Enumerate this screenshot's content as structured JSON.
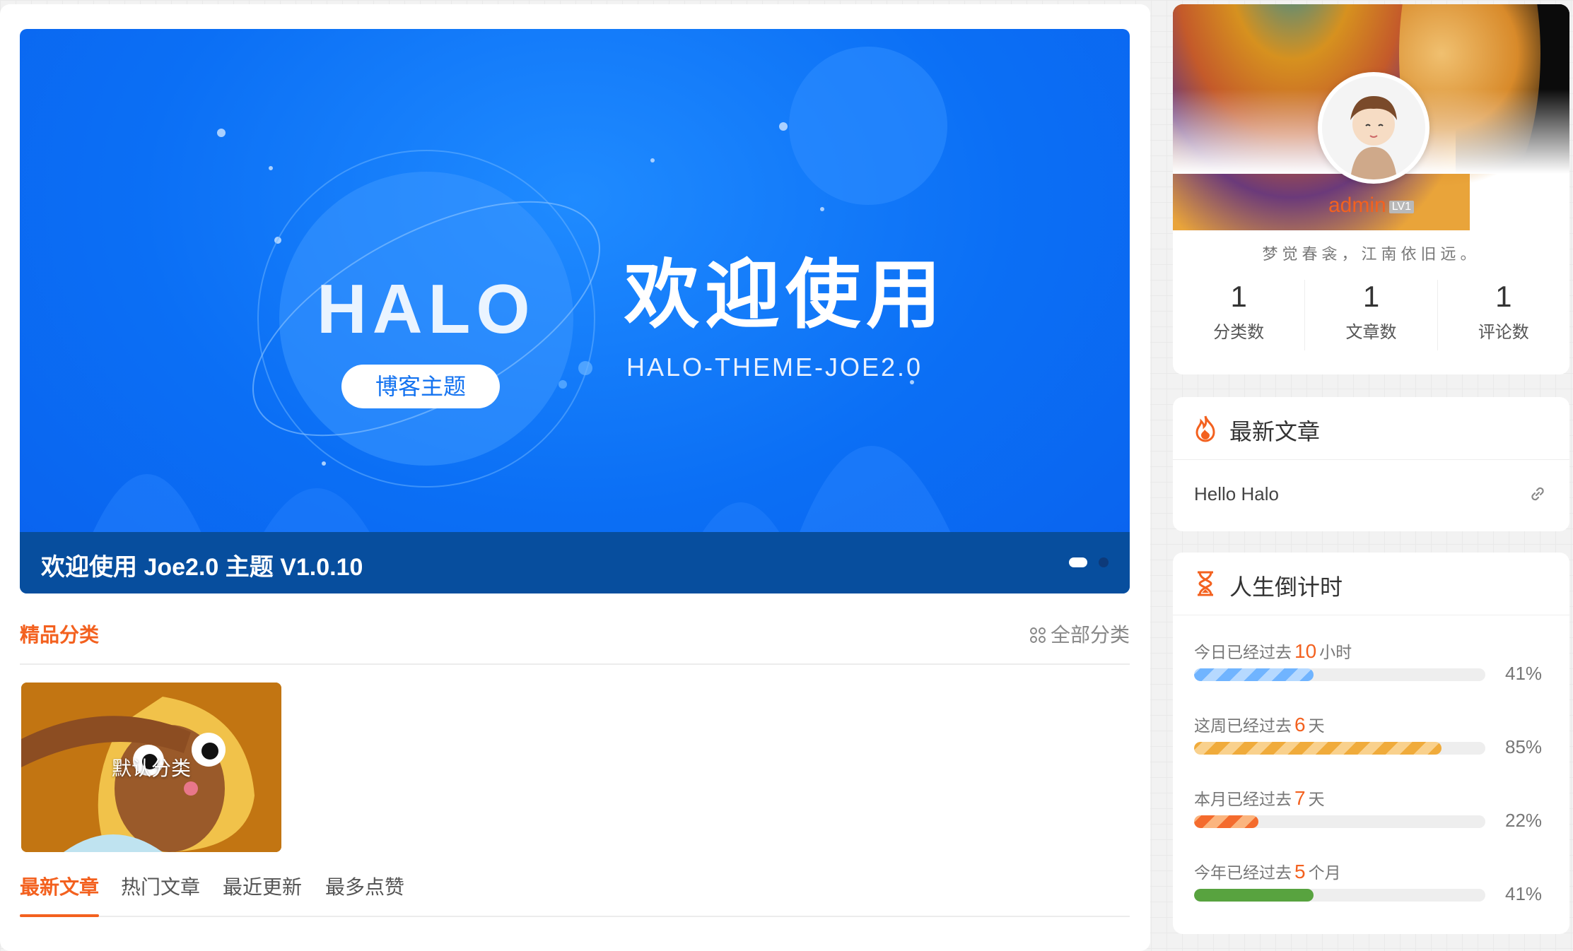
{
  "banner": {
    "halo_text": "HALO",
    "halo_pill": "博客主题",
    "title": "欢迎使用",
    "subtitle": "HALO-THEME-JOE2.0",
    "caption": "欢迎使用 Joe2.0 主题  V1.0.10",
    "slide_count": 2,
    "active_slide": 1
  },
  "featured": {
    "title": "精品分类",
    "more": "全部分类",
    "categories": [
      {
        "label": "默认分类"
      }
    ]
  },
  "tabs": [
    "最新文章",
    "热门文章",
    "最近更新",
    "最多点赞"
  ],
  "active_tab": 0,
  "profile": {
    "name": "admin",
    "level": "LV1",
    "motto": "梦觉春衾，江南依旧远。",
    "stats": [
      {
        "num": "1",
        "label": "分类数"
      },
      {
        "num": "1",
        "label": "文章数"
      },
      {
        "num": "1",
        "label": "评论数"
      }
    ]
  },
  "latest": {
    "title": "最新文章",
    "items": [
      {
        "title": "Hello Halo"
      }
    ]
  },
  "countdown": {
    "title": "人生倒计时",
    "rows": [
      {
        "prefix": "今日已经过去",
        "value": "10",
        "unit": "小时",
        "percent": "41%",
        "fill": 0.41
      },
      {
        "prefix": "这周已经过去",
        "value": "6",
        "unit": "天",
        "percent": "85%",
        "fill": 0.85
      },
      {
        "prefix": "本月已经过去",
        "value": "7",
        "unit": "天",
        "percent": "22%",
        "fill": 0.22
      },
      {
        "prefix": "今年已经过去",
        "value": "5",
        "unit": "个月",
        "percent": "41%",
        "fill": 0.41
      }
    ]
  },
  "colors": {
    "accent": "#f3611f",
    "banner_blue": "#0b6ff5",
    "caption_bar": "#074e9e"
  }
}
